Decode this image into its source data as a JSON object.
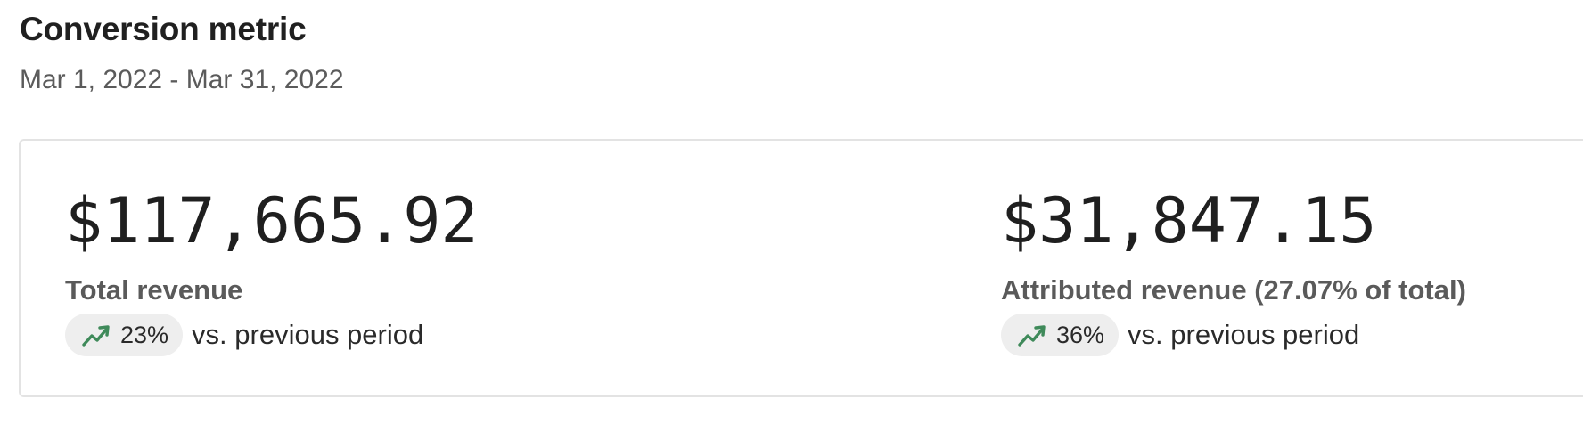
{
  "header": {
    "title": "Conversion metric",
    "date_range": "Mar 1, 2022 - Mar 31, 2022"
  },
  "metrics": [
    {
      "value": "$117,665.92",
      "label": "Total revenue",
      "delta": "23%",
      "delta_suffix": "vs. previous period",
      "trend_icon": "trending-up-icon"
    },
    {
      "value": "$31,847.15",
      "label": "Attributed revenue (27.07% of total)",
      "delta": "36%",
      "delta_suffix": "vs. previous period",
      "trend_icon": "trending-up-icon"
    }
  ],
  "colors": {
    "trend_up": "#3f8a5a",
    "pill_background": "#eeeeee",
    "card_border": "#e3e3e3"
  }
}
